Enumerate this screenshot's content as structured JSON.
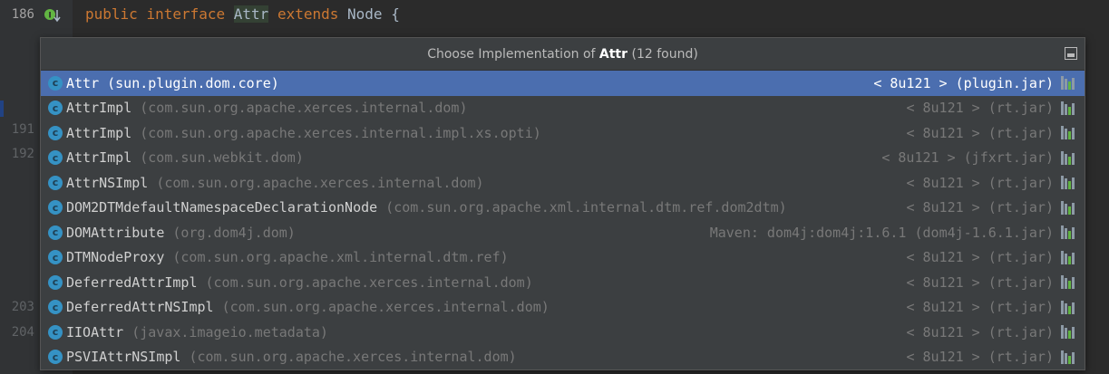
{
  "editor": {
    "line_numbers": [
      "186",
      "191",
      "192",
      "203",
      "204"
    ],
    "code": {
      "kw1": "public",
      "kw2": "interface",
      "name": "Attr",
      "kw3": "extends",
      "rest": "Node {"
    }
  },
  "popup": {
    "title_prefix": "Choose Implementation of ",
    "title_bold": "Attr",
    "title_suffix": " (12 found)",
    "items": [
      {
        "name": "Attr",
        "pkg": "(sun.plugin.dom.core)",
        "loc": "< 8u121 > (plugin.jar)"
      },
      {
        "name": "AttrImpl",
        "pkg": "(com.sun.org.apache.xerces.internal.dom)",
        "loc": "< 8u121 > (rt.jar)"
      },
      {
        "name": "AttrImpl",
        "pkg": "(com.sun.org.apache.xerces.internal.impl.xs.opti)",
        "loc": "< 8u121 > (rt.jar)"
      },
      {
        "name": "AttrImpl",
        "pkg": "(com.sun.webkit.dom)",
        "loc": "< 8u121 > (jfxrt.jar)"
      },
      {
        "name": "AttrNSImpl",
        "pkg": "(com.sun.org.apache.xerces.internal.dom)",
        "loc": "< 8u121 > (rt.jar)"
      },
      {
        "name": "DOM2DTMdefaultNamespaceDeclarationNode",
        "pkg": "(com.sun.org.apache.xml.internal.dtm.ref.dom2dtm)",
        "loc": "< 8u121 > (rt.jar)"
      },
      {
        "name": "DOMAttribute",
        "pkg": "(org.dom4j.dom)",
        "loc": "Maven: dom4j:dom4j:1.6.1 (dom4j-1.6.1.jar)"
      },
      {
        "name": "DTMNodeProxy",
        "pkg": "(com.sun.org.apache.xml.internal.dtm.ref)",
        "loc": "< 8u121 > (rt.jar)"
      },
      {
        "name": "DeferredAttrImpl",
        "pkg": "(com.sun.org.apache.xerces.internal.dom)",
        "loc": "< 8u121 > (rt.jar)"
      },
      {
        "name": "DeferredAttrNSImpl",
        "pkg": "(com.sun.org.apache.xerces.internal.dom)",
        "loc": "< 8u121 > (rt.jar)"
      },
      {
        "name": "IIOAttr",
        "pkg": "(javax.imageio.metadata)",
        "loc": "< 8u121 > (rt.jar)"
      },
      {
        "name": "PSVIAttrNSImpl",
        "pkg": "(com.sun.org.apache.xerces.internal.dom)",
        "loc": "< 8u121 > (rt.jar)"
      }
    ],
    "selected_index": 0
  },
  "colors": {
    "selection": "#4b6eaf",
    "class_icon": "#3592c4",
    "keyword": "#cc7832"
  },
  "icons": {
    "row_icon": "class-icon",
    "library_icon": "library-jar-icon",
    "header_button": "pin-window-icon",
    "gutter_icon": "implemented-by-icon"
  }
}
